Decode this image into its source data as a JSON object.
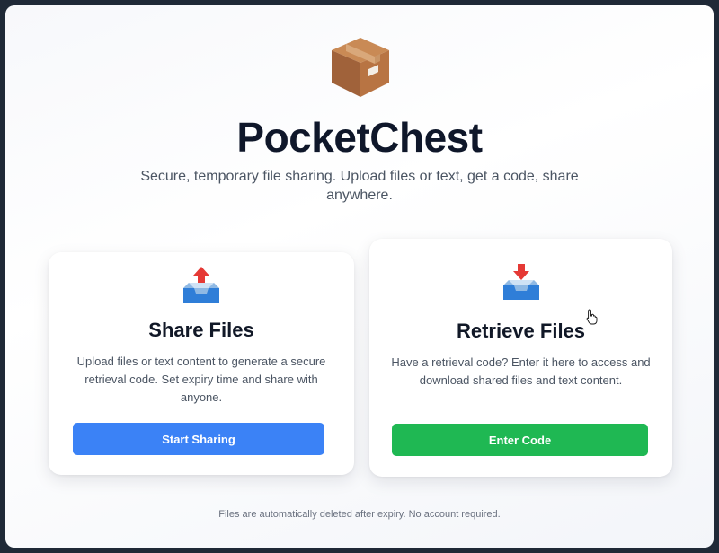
{
  "app": {
    "title": "PocketChest",
    "subtitle": "Secure, temporary file sharing. Upload files or text, get a code, share anywhere.",
    "logo_icon": "package-box-icon"
  },
  "cards": {
    "share": {
      "icon": "outbox-tray-icon",
      "title": "Share Files",
      "description": "Upload files or text content to generate a secure retrieval code. Set expiry time and share with anyone.",
      "button_label": "Start Sharing",
      "button_color": "#3b82f6"
    },
    "retrieve": {
      "icon": "inbox-tray-icon",
      "title": "Retrieve Files",
      "description": "Have a retrieval code? Enter it here to access and download shared files and text content.",
      "button_label": "Enter Code",
      "button_color": "#1fb853"
    }
  },
  "footer": {
    "text": "Files are automatically deleted after expiry. No account required."
  }
}
